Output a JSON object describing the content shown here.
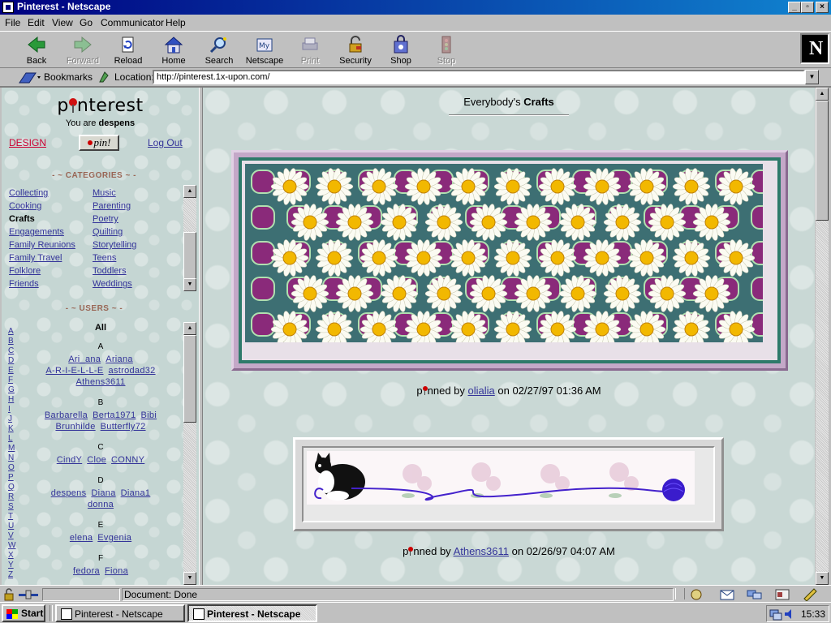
{
  "window": {
    "title": "Pinterest - Netscape"
  },
  "menu": [
    "File",
    "Edit",
    "View",
    "Go",
    "Communicator",
    "Help"
  ],
  "toolbar": {
    "buttons": [
      {
        "label": "Back",
        "icon": "back-arrow-icon",
        "enabled": true
      },
      {
        "label": "Forward",
        "icon": "forward-arrow-icon",
        "enabled": false
      },
      {
        "label": "Reload",
        "icon": "reload-icon",
        "enabled": true
      },
      {
        "label": "Home",
        "icon": "home-icon",
        "enabled": true
      },
      {
        "label": "Search",
        "icon": "search-icon",
        "enabled": true
      },
      {
        "label": "Netscape",
        "icon": "netscape-icon",
        "enabled": true
      },
      {
        "label": "Print",
        "icon": "print-icon",
        "enabled": false
      },
      {
        "label": "Security",
        "icon": "security-lock-icon",
        "enabled": true
      },
      {
        "label": "Shop",
        "icon": "shop-bag-icon",
        "enabled": true
      },
      {
        "label": "Stop",
        "icon": "stop-icon",
        "enabled": false
      }
    ],
    "logo": "N"
  },
  "location": {
    "bookmarks_label": "Bookmarks",
    "location_label": "Location:",
    "url": "http://pinterest.1x-upon.com/"
  },
  "sidebar": {
    "logo_pre": "p",
    "logo_post": "nterest",
    "you_are_prefix": "You are ",
    "username": "despens",
    "design_link": "DESIGN",
    "pin_button": "pin!",
    "logout_link": "Log Out",
    "categories_heading": "- ~ CATEGORIES ~ -",
    "categories_left": [
      "Collecting",
      "Cooking",
      "Crafts",
      "Engagements",
      "Family Reunions",
      "Family Travel",
      "Folklore",
      "Friends"
    ],
    "categories_right": [
      "Music",
      "Parenting",
      "Poetry",
      "Quilting",
      "Storytelling",
      "Teens",
      "Toddlers",
      "Weddings"
    ],
    "current_category": "Crafts",
    "users_heading": "- ~ USERS ~ -",
    "letters": [
      "A",
      "B",
      "C",
      "D",
      "E",
      "F",
      "G",
      "H",
      "I",
      "J",
      "K",
      "L",
      "M",
      "N",
      "O",
      "P",
      "Q",
      "R",
      "S",
      "T",
      "U",
      "V",
      "W",
      "X",
      "Y",
      "Z"
    ],
    "users_all": "All",
    "user_groups": [
      {
        "letter": "A",
        "rows": [
          [
            "Ari_ana",
            "Ariana"
          ],
          [
            "A-R-I-E-L-L-E",
            "astrodad32"
          ],
          [
            "Athens3611"
          ]
        ]
      },
      {
        "letter": "B",
        "rows": [
          [
            "Barbarella",
            "Berta1971",
            "Bibi"
          ],
          [
            "Brunhilde",
            "Butterfly72"
          ]
        ]
      },
      {
        "letter": "C",
        "rows": [
          [
            "CindY",
            "Cloe",
            "CONNY"
          ]
        ]
      },
      {
        "letter": "D",
        "rows": [
          [
            "despens",
            "Diana",
            "Diana1"
          ],
          [
            "donna"
          ]
        ]
      },
      {
        "letter": "E",
        "rows": [
          [
            "elena",
            "Evgenia"
          ]
        ]
      },
      {
        "letter": "F",
        "rows": [
          [
            "fedora",
            "Fiona"
          ]
        ]
      }
    ]
  },
  "main": {
    "heading_prefix": "Everybody's ",
    "heading_category": "Crafts",
    "pins": [
      {
        "caption_pre": "p",
        "caption_mid": "nned by ",
        "user": "olialia",
        "date": " on 02/27/97 01:36 AM"
      },
      {
        "caption_pre": "p",
        "caption_mid": "nned by ",
        "user": "Athens3611",
        "date": " on 02/26/97 04:07 AM"
      }
    ]
  },
  "status": {
    "text": "Document: Done"
  },
  "taskbar": {
    "start": "Start",
    "tasks": [
      "Pinterest - Netscape",
      "Pinterest - Netscape"
    ],
    "clock": "15:33"
  },
  "colors": {
    "titlebar": "#000080",
    "link": "#333399",
    "design_link": "#cc0033",
    "pin_red": "#d01010"
  }
}
